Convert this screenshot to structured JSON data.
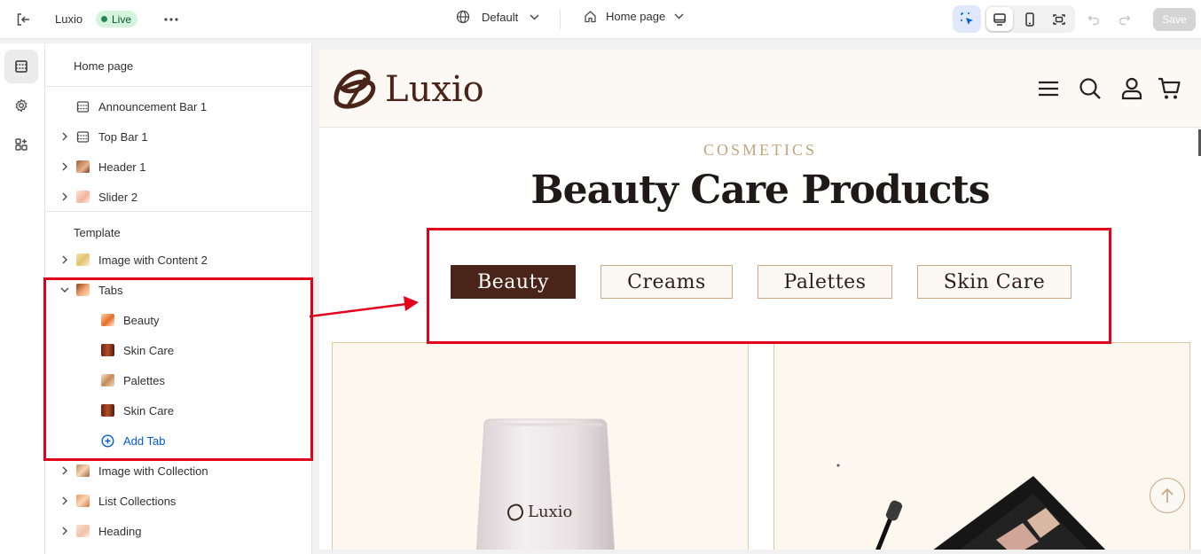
{
  "topbar": {
    "app_name": "Luxio",
    "status_badge": "Live",
    "theme_selector": "Default",
    "page_selector": "Home page",
    "save_label": "Save"
  },
  "panel": {
    "title": "Home page",
    "header_items": [
      {
        "label": "Announcement Bar 1",
        "icon": "layout-section-icon",
        "expandable": false
      },
      {
        "label": "Top Bar 1",
        "icon": "layout-section-icon",
        "expandable": true
      },
      {
        "label": "Header 1",
        "icon": "header-thumb",
        "expandable": true
      },
      {
        "label": "Slider 2",
        "icon": "slider-thumb",
        "expandable": true
      }
    ],
    "template_label": "Template",
    "template_items": [
      {
        "label": "Image with Content 2",
        "expandable": true
      },
      {
        "label": "Tabs",
        "expandable": true,
        "expanded": true
      },
      {
        "label": "Image with Collection",
        "expandable": true
      },
      {
        "label": "List Collections",
        "expandable": true
      },
      {
        "label": "Heading",
        "expandable": true
      }
    ],
    "tab_blocks": [
      "Beauty",
      "Skin Care",
      "Palettes",
      "Skin Care"
    ],
    "add_tab_label": "Add Tab"
  },
  "preview": {
    "logo_text": "Luxio",
    "eyebrow": "COSMETICS",
    "section_title": "Beauty Care Products",
    "tabs": [
      "Beauty",
      "Creams",
      "Palettes",
      "Skin Care"
    ],
    "active_tab": "Beauty",
    "product_logo_text": "Luxio"
  },
  "colors": {
    "brand_brown": "#4a2418",
    "accent_gold": "#c4a57e",
    "annotation_red": "#e3001b",
    "link_blue": "#005bd3",
    "live_green": "#29845a"
  }
}
